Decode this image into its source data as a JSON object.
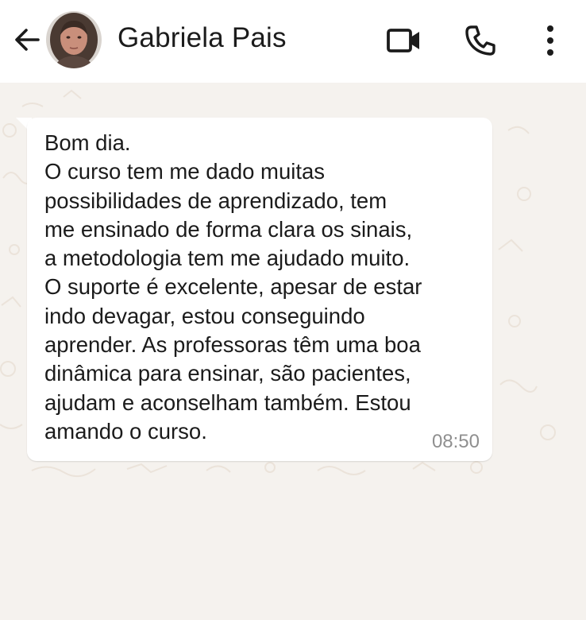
{
  "header": {
    "back_icon": "arrow-left-icon",
    "contact_name": "Gabriela Pais",
    "video_icon": "video-camera-icon",
    "phone_icon": "phone-icon",
    "menu_icon": "more-vertical-icon"
  },
  "chat": {
    "messages": [
      {
        "direction": "incoming",
        "text": "Bom dia.\nO curso tem me dado muitas\npossibilidades de aprendizado, tem\nme ensinado de forma clara os sinais,\na metodologia tem me ajudado muito.\nO suporte é excelente, apesar de estar\nindo devagar, estou conseguindo\naprender. As professoras têm uma boa\ndinâmica para ensinar, são pacientes,\najudam e aconselham também. Estou\namando o curso.",
        "time": "08:50"
      }
    ]
  },
  "colors": {
    "header_bg": "#ffffff",
    "chat_bg": "#f5f2ee",
    "bubble_bg": "#ffffff",
    "text": "#1b1b1b",
    "time": "#8f8f8f"
  }
}
